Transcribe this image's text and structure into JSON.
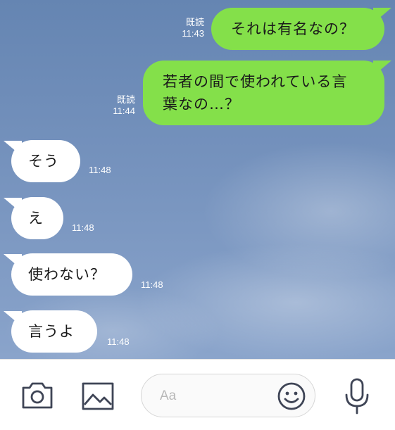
{
  "messages": [
    {
      "direction": "outgoing",
      "text_lines": [
        "それは有名なの？"
      ],
      "read_label": "既読",
      "time": "11:43"
    },
    {
      "direction": "outgoing",
      "text_lines": [
        "若者の間で使われている言",
        "葉なの…？"
      ],
      "read_label": "既読",
      "time": "11:44"
    },
    {
      "direction": "incoming",
      "text_lines": [
        "そう"
      ],
      "time": "11:48"
    },
    {
      "direction": "incoming",
      "text_lines": [
        "え"
      ],
      "time": "11:48"
    },
    {
      "direction": "incoming",
      "text_lines": [
        "使わない？"
      ],
      "time": "11:48"
    },
    {
      "direction": "incoming",
      "text_lines": [
        "言うよ"
      ],
      "time": "11:48"
    }
  ],
  "input": {
    "placeholder": "Aa"
  },
  "icons": {
    "camera": "camera-icon",
    "image": "image-icon",
    "emoji": "emoji-icon",
    "mic": "microphone-icon"
  },
  "colors": {
    "outgoing_bubble": "#84e04a",
    "incoming_bubble": "#ffffff",
    "chat_background": "#7592bd",
    "icon_stroke": "#3f4556"
  }
}
